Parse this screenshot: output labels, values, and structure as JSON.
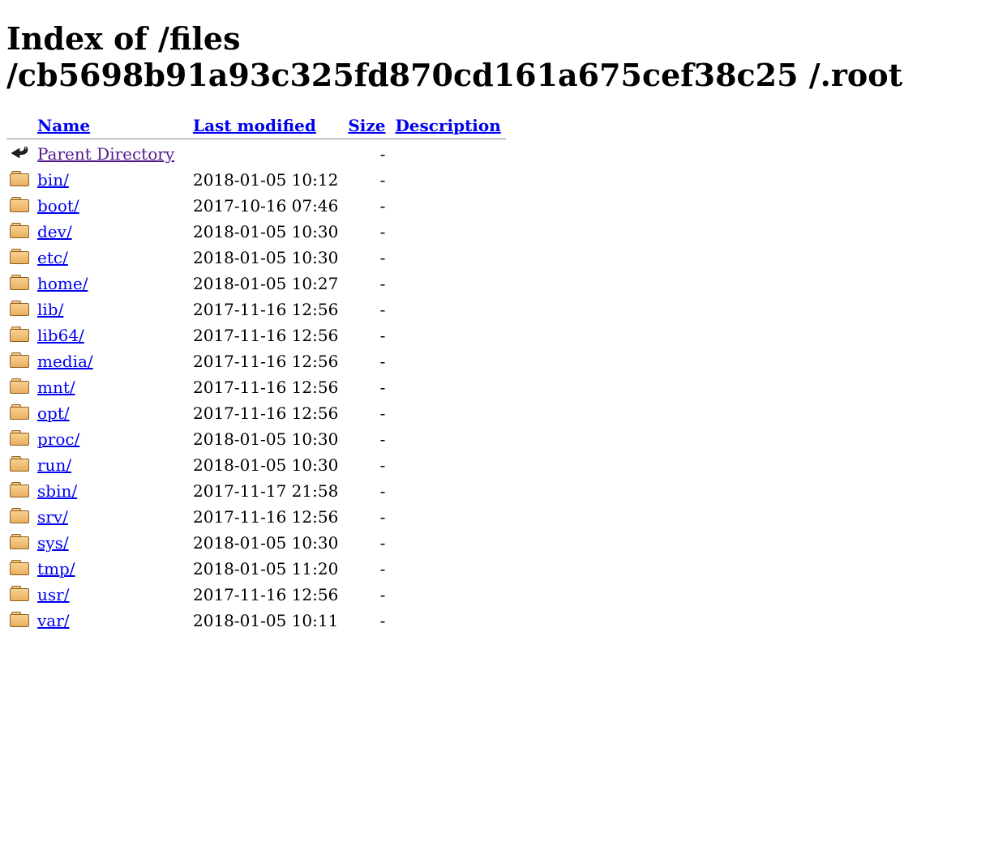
{
  "heading": "Index of /files /cb5698b91a93c325fd870cd161a675cef38c25 /.root",
  "columns": {
    "name": "Name",
    "modified": "Last modified",
    "size": "Size",
    "description": "Description"
  },
  "parent": {
    "label": "Parent Directory",
    "size": "-"
  },
  "entries": [
    {
      "name": "bin/",
      "modified": "2018-01-05 10:12",
      "size": "-"
    },
    {
      "name": "boot/",
      "modified": "2017-10-16 07:46",
      "size": "-"
    },
    {
      "name": "dev/",
      "modified": "2018-01-05 10:30",
      "size": "-"
    },
    {
      "name": "etc/",
      "modified": "2018-01-05 10:30",
      "size": "-"
    },
    {
      "name": "home/",
      "modified": "2018-01-05 10:27",
      "size": "-"
    },
    {
      "name": "lib/",
      "modified": "2017-11-16 12:56",
      "size": "-"
    },
    {
      "name": "lib64/",
      "modified": "2017-11-16 12:56",
      "size": "-"
    },
    {
      "name": "media/",
      "modified": "2017-11-16 12:56",
      "size": "-"
    },
    {
      "name": "mnt/",
      "modified": "2017-11-16 12:56",
      "size": "-"
    },
    {
      "name": "opt/",
      "modified": "2017-11-16 12:56",
      "size": "-"
    },
    {
      "name": "proc/",
      "modified": "2018-01-05 10:30",
      "size": "-"
    },
    {
      "name": "run/",
      "modified": "2018-01-05 10:30",
      "size": "-"
    },
    {
      "name": "sbin/",
      "modified": "2017-11-17 21:58",
      "size": "-"
    },
    {
      "name": "srv/",
      "modified": "2017-11-16 12:56",
      "size": "-"
    },
    {
      "name": "sys/",
      "modified": "2018-01-05 10:30",
      "size": "-"
    },
    {
      "name": "tmp/",
      "modified": "2018-01-05 11:20",
      "size": "-"
    },
    {
      "name": "usr/",
      "modified": "2017-11-16 12:56",
      "size": "-"
    },
    {
      "name": "var/",
      "modified": "2018-01-05 10:11",
      "size": "-"
    }
  ]
}
